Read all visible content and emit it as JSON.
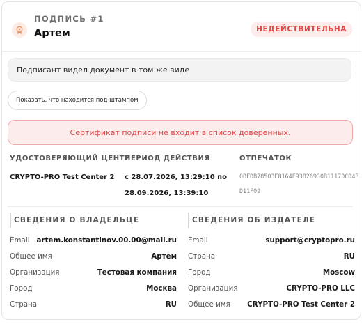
{
  "signature": {
    "label": "ПОДПИСЬ #1",
    "name": "Артем",
    "status": "НЕДЕЙСТВИТЕЛЬНА",
    "note": "Подписант видел документ в том же виде",
    "show_button": "Показать, что находится под штампом",
    "alert": "Сертификат подписи не входит в список доверенных."
  },
  "certificate": {
    "ca_label": "УДОСТОВЕРЯЮЩИЙ ЦЕНТР",
    "ca_value": "CRYPTO-PRO Test Center 2",
    "period_label": "ПЕРИОД ДЕЙСТВИЯ",
    "period_from": "с 28.07.2026, 13:29:10 по",
    "period_to": "28.09.2026, 13:39:10",
    "thumb_label": "ОТПЕЧАТОК",
    "thumb_value": "0BFDB78503E8164F93826930B11170CD4BD11F09"
  },
  "owner": {
    "title": "СВЕДЕНИЯ О ВЛАДЕЛЬЦЕ",
    "rows": [
      {
        "key": "Email",
        "value": "artem.konstantinov.00.00@mail.ru"
      },
      {
        "key": "Общее имя",
        "value": "Артем"
      },
      {
        "key": "Организация",
        "value": "Тестовая компания"
      },
      {
        "key": "Город",
        "value": "Москва"
      },
      {
        "key": "Страна",
        "value": "RU"
      }
    ]
  },
  "issuer": {
    "title": "СВЕДЕНИЯ ОБ ИЗДАТЕЛЕ",
    "rows": [
      {
        "key": "Email",
        "value": "support@cryptopro.ru"
      },
      {
        "key": "Страна",
        "value": "RU"
      },
      {
        "key": "Город",
        "value": "Moscow"
      },
      {
        "key": "Организация",
        "value": "CRYPTO-PRO LLC"
      },
      {
        "key": "Общее имя",
        "value": "CRYPTO-PRO Test Center 2"
      }
    ]
  },
  "colors": {
    "accent_red": "#e04848",
    "badge_bg": "#fdecec",
    "seal": "#e8956b"
  },
  "icons": {
    "seal": "seal-icon"
  }
}
